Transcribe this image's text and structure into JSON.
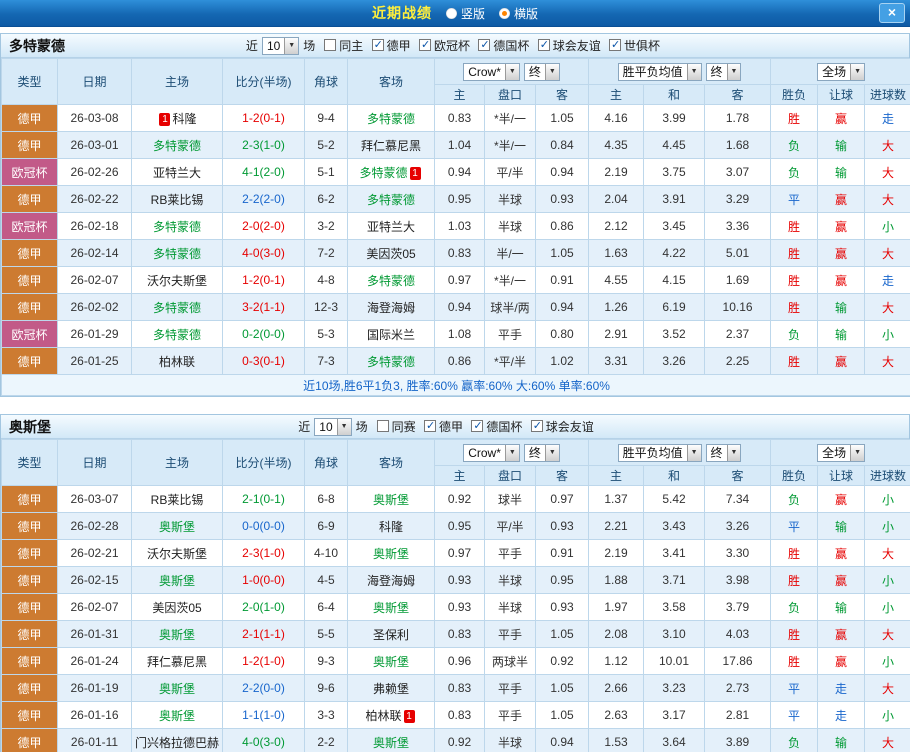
{
  "icons": {
    "close": "×",
    "dropdown_arrow": "▼",
    "checkbox_check": "✓"
  },
  "title_bar": {
    "title": "近期战绩",
    "radios": [
      {
        "label": "竖版",
        "selected": false,
        "cls": "radio"
      },
      {
        "label": "横版",
        "selected": true,
        "cls": "radio on"
      }
    ]
  },
  "filter_labels": {
    "near": "近",
    "games": "场"
  },
  "header_selects": {
    "odds_source": "Crow*",
    "odds_time": "终",
    "europe_source": "胜平负均值",
    "europe_time": "终",
    "scope": "全场"
  },
  "columns": [
    "类型",
    "日期",
    "主场",
    "比分(半场)",
    "角球",
    "客场",
    "主",
    "盘口",
    "客",
    "主",
    "和",
    "客",
    "胜负",
    "让球",
    "进球数"
  ],
  "sections": [
    {
      "team": "多特蒙德",
      "filter": {
        "count": "10",
        "checks": [
          {
            "label": "同主",
            "cls": "cb"
          },
          {
            "label": "德甲",
            "cls": "cb on"
          },
          {
            "label": "欧冠杯",
            "cls": "cb on"
          },
          {
            "label": "德国杯",
            "cls": "cb on"
          },
          {
            "label": "球会友谊",
            "cls": "cb on"
          },
          {
            "label": "世俱杯",
            "cls": "cb on"
          }
        ]
      },
      "rows": [
        {
          "lg": "德甲",
          "lgc": "lg-de",
          "date": "26-03-08",
          "hb": "1",
          "home": "科隆",
          "hc": "c-blk",
          "hba": "",
          "score": "1-2(0-1)",
          "sc": "c-red",
          "corner": "9-4",
          "ab": "",
          "away": "多特蒙德",
          "ac": "c-grn",
          "aba": "",
          "o1": "0.83",
          "pk": "*半/一",
          "o2": "1.05",
          "e1": "4.16",
          "e2": "3.99",
          "e3": "1.78",
          "r1": "胜",
          "r1c": "c-red",
          "r2": "赢",
          "r2c": "c-red",
          "r3": "走",
          "r3c": "c-blu"
        },
        {
          "lg": "德甲",
          "lgc": "lg-de",
          "date": "26-03-01",
          "hb": "",
          "home": "多特蒙德",
          "hc": "c-grn",
          "hba": "",
          "score": "2-3(1-0)",
          "sc": "c-grn",
          "corner": "5-2",
          "ab": "",
          "away": "拜仁慕尼黑",
          "ac": "c-blk",
          "aba": "",
          "o1": "1.04",
          "pk": "*半/一",
          "o2": "0.84",
          "e1": "4.35",
          "e2": "4.45",
          "e3": "1.68",
          "r1": "负",
          "r1c": "c-grn",
          "r2": "输",
          "r2c": "c-grn",
          "r3": "大",
          "r3c": "c-red"
        },
        {
          "lg": "欧冠杯",
          "lgc": "lg-cl",
          "date": "26-02-26",
          "hb": "",
          "home": "亚特兰大",
          "hc": "c-blk",
          "hba": "",
          "score": "4-1(2-0)",
          "sc": "c-grn",
          "corner": "5-1",
          "ab": "",
          "away": "多特蒙德",
          "ac": "c-grn",
          "aba": "1",
          "o1": "0.94",
          "pk": "平/半",
          "o2": "0.94",
          "e1": "2.19",
          "e2": "3.75",
          "e3": "3.07",
          "r1": "负",
          "r1c": "c-grn",
          "r2": "输",
          "r2c": "c-grn",
          "r3": "大",
          "r3c": "c-red"
        },
        {
          "lg": "德甲",
          "lgc": "lg-de",
          "date": "26-02-22",
          "hb": "",
          "home": "RB莱比锡",
          "hc": "c-blk",
          "hba": "",
          "score": "2-2(2-0)",
          "sc": "c-blu",
          "corner": "6-2",
          "ab": "",
          "away": "多特蒙德",
          "ac": "c-grn",
          "aba": "",
          "o1": "0.95",
          "pk": "半球",
          "o2": "0.93",
          "e1": "2.04",
          "e2": "3.91",
          "e3": "3.29",
          "r1": "平",
          "r1c": "c-blu",
          "r2": "赢",
          "r2c": "c-red",
          "r3": "大",
          "r3c": "c-red"
        },
        {
          "lg": "欧冠杯",
          "lgc": "lg-cl",
          "date": "26-02-18",
          "hb": "",
          "home": "多特蒙德",
          "hc": "c-grn",
          "hba": "",
          "score": "2-0(2-0)",
          "sc": "c-red",
          "corner": "3-2",
          "ab": "",
          "away": "亚特兰大",
          "ac": "c-blk",
          "aba": "",
          "o1": "1.03",
          "pk": "半球",
          "o2": "0.86",
          "e1": "2.12",
          "e2": "3.45",
          "e3": "3.36",
          "r1": "胜",
          "r1c": "c-red",
          "r2": "赢",
          "r2c": "c-red",
          "r3": "小",
          "r3c": "c-grn"
        },
        {
          "lg": "德甲",
          "lgc": "lg-de",
          "date": "26-02-14",
          "hb": "",
          "home": "多特蒙德",
          "hc": "c-grn",
          "hba": "",
          "score": "4-0(3-0)",
          "sc": "c-red",
          "corner": "7-2",
          "ab": "",
          "away": "美因茨05",
          "ac": "c-blk",
          "aba": "",
          "o1": "0.83",
          "pk": "半/一",
          "o2": "1.05",
          "e1": "1.63",
          "e2": "4.22",
          "e3": "5.01",
          "r1": "胜",
          "r1c": "c-red",
          "r2": "赢",
          "r2c": "c-red",
          "r3": "大",
          "r3c": "c-red"
        },
        {
          "lg": "德甲",
          "lgc": "lg-de",
          "date": "26-02-07",
          "hb": "",
          "home": "沃尔夫斯堡",
          "hc": "c-blk",
          "hba": "",
          "score": "1-2(0-1)",
          "sc": "c-red",
          "corner": "4-8",
          "ab": "",
          "away": "多特蒙德",
          "ac": "c-grn",
          "aba": "",
          "o1": "0.97",
          "pk": "*半/一",
          "o2": "0.91",
          "e1": "4.55",
          "e2": "4.15",
          "e3": "1.69",
          "r1": "胜",
          "r1c": "c-red",
          "r2": "赢",
          "r2c": "c-red",
          "r3": "走",
          "r3c": "c-blu"
        },
        {
          "lg": "德甲",
          "lgc": "lg-de",
          "date": "26-02-02",
          "hb": "",
          "home": "多特蒙德",
          "hc": "c-grn",
          "hba": "",
          "score": "3-2(1-1)",
          "sc": "c-red",
          "corner": "12-3",
          "ab": "",
          "away": "海登海姆",
          "ac": "c-blk",
          "aba": "",
          "o1": "0.94",
          "pk": "球半/两",
          "o2": "0.94",
          "e1": "1.26",
          "e2": "6.19",
          "e3": "10.16",
          "r1": "胜",
          "r1c": "c-red",
          "r2": "输",
          "r2c": "c-grn",
          "r3": "大",
          "r3c": "c-red"
        },
        {
          "lg": "欧冠杯",
          "lgc": "lg-cl",
          "date": "26-01-29",
          "hb": "",
          "home": "多特蒙德",
          "hc": "c-grn",
          "hba": "",
          "score": "0-2(0-0)",
          "sc": "c-grn",
          "corner": "5-3",
          "ab": "",
          "away": "国际米兰",
          "ac": "c-blk",
          "aba": "",
          "o1": "1.08",
          "pk": "平手",
          "o2": "0.80",
          "e1": "2.91",
          "e2": "3.52",
          "e3": "2.37",
          "r1": "负",
          "r1c": "c-grn",
          "r2": "输",
          "r2c": "c-grn",
          "r3": "小",
          "r3c": "c-grn"
        },
        {
          "lg": "德甲",
          "lgc": "lg-de",
          "date": "26-01-25",
          "hb": "",
          "home": "柏林联",
          "hc": "c-blk",
          "hba": "",
          "score": "0-3(0-1)",
          "sc": "c-red",
          "corner": "7-3",
          "ab": "",
          "away": "多特蒙德",
          "ac": "c-grn",
          "aba": "",
          "o1": "0.86",
          "pk": "*平/半",
          "o2": "1.02",
          "e1": "3.31",
          "e2": "3.26",
          "e3": "2.25",
          "r1": "胜",
          "r1c": "c-red",
          "r2": "赢",
          "r2c": "c-red",
          "r3": "大",
          "r3c": "c-red"
        }
      ],
      "summary": "近10场,胜6平1负3, 胜率:60%  赢率:60%  大:60%  单率:60%"
    },
    {
      "team": "奥斯堡",
      "filter": {
        "count": "10",
        "checks": [
          {
            "label": "同赛",
            "cls": "cb"
          },
          {
            "label": "德甲",
            "cls": "cb on"
          },
          {
            "label": "德国杯",
            "cls": "cb on"
          },
          {
            "label": "球会友谊",
            "cls": "cb on"
          }
        ]
      },
      "rows": [
        {
          "lg": "德甲",
          "lgc": "lg-de",
          "date": "26-03-07",
          "hb": "",
          "home": "RB莱比锡",
          "hc": "c-blk",
          "hba": "",
          "score": "2-1(0-1)",
          "sc": "c-grn",
          "corner": "6-8",
          "ab": "",
          "away": "奥斯堡",
          "ac": "c-grn",
          "aba": "",
          "o1": "0.92",
          "pk": "球半",
          "o2": "0.97",
          "e1": "1.37",
          "e2": "5.42",
          "e3": "7.34",
          "r1": "负",
          "r1c": "c-grn",
          "r2": "赢",
          "r2c": "c-red",
          "r3": "小",
          "r3c": "c-grn"
        },
        {
          "lg": "德甲",
          "lgc": "lg-de",
          "date": "26-02-28",
          "hb": "",
          "home": "奥斯堡",
          "hc": "c-grn",
          "hba": "",
          "score": "0-0(0-0)",
          "sc": "c-blu",
          "corner": "6-9",
          "ab": "",
          "away": "科隆",
          "ac": "c-blk",
          "aba": "",
          "o1": "0.95",
          "pk": "平/半",
          "o2": "0.93",
          "e1": "2.21",
          "e2": "3.43",
          "e3": "3.26",
          "r1": "平",
          "r1c": "c-blu",
          "r2": "输",
          "r2c": "c-grn",
          "r3": "小",
          "r3c": "c-grn"
        },
        {
          "lg": "德甲",
          "lgc": "lg-de",
          "date": "26-02-21",
          "hb": "",
          "home": "沃尔夫斯堡",
          "hc": "c-blk",
          "hba": "",
          "score": "2-3(1-0)",
          "sc": "c-red",
          "corner": "4-10",
          "ab": "",
          "away": "奥斯堡",
          "ac": "c-grn",
          "aba": "",
          "o1": "0.97",
          "pk": "平手",
          "o2": "0.91",
          "e1": "2.19",
          "e2": "3.41",
          "e3": "3.30",
          "r1": "胜",
          "r1c": "c-red",
          "r2": "赢",
          "r2c": "c-red",
          "r3": "大",
          "r3c": "c-red"
        },
        {
          "lg": "德甲",
          "lgc": "lg-de",
          "date": "26-02-15",
          "hb": "",
          "home": "奥斯堡",
          "hc": "c-grn",
          "hba": "",
          "score": "1-0(0-0)",
          "sc": "c-red",
          "corner": "4-5",
          "ab": "",
          "away": "海登海姆",
          "ac": "c-blk",
          "aba": "",
          "o1": "0.93",
          "pk": "半球",
          "o2": "0.95",
          "e1": "1.88",
          "e2": "3.71",
          "e3": "3.98",
          "r1": "胜",
          "r1c": "c-red",
          "r2": "赢",
          "r2c": "c-red",
          "r3": "小",
          "r3c": "c-grn"
        },
        {
          "lg": "德甲",
          "lgc": "lg-de",
          "date": "26-02-07",
          "hb": "",
          "home": "美因茨05",
          "hc": "c-blk",
          "hba": "",
          "score": "2-0(1-0)",
          "sc": "c-grn",
          "corner": "6-4",
          "ab": "",
          "away": "奥斯堡",
          "ac": "c-grn",
          "aba": "",
          "o1": "0.93",
          "pk": "半球",
          "o2": "0.93",
          "e1": "1.97",
          "e2": "3.58",
          "e3": "3.79",
          "r1": "负",
          "r1c": "c-grn",
          "r2": "输",
          "r2c": "c-grn",
          "r3": "小",
          "r3c": "c-grn"
        },
        {
          "lg": "德甲",
          "lgc": "lg-de",
          "date": "26-01-31",
          "hb": "",
          "home": "奥斯堡",
          "hc": "c-grn",
          "hba": "",
          "score": "2-1(1-1)",
          "sc": "c-red",
          "corner": "5-5",
          "ab": "",
          "away": "圣保利",
          "ac": "c-blk",
          "aba": "",
          "o1": "0.83",
          "pk": "平手",
          "o2": "1.05",
          "e1": "2.08",
          "e2": "3.10",
          "e3": "4.03",
          "r1": "胜",
          "r1c": "c-red",
          "r2": "赢",
          "r2c": "c-red",
          "r3": "大",
          "r3c": "c-red"
        },
        {
          "lg": "德甲",
          "lgc": "lg-de",
          "date": "26-01-24",
          "hb": "",
          "home": "拜仁慕尼黑",
          "hc": "c-blk",
          "hba": "",
          "score": "1-2(1-0)",
          "sc": "c-red",
          "corner": "9-3",
          "ab": "",
          "away": "奥斯堡",
          "ac": "c-grn",
          "aba": "",
          "o1": "0.96",
          "pk": "两球半",
          "o2": "0.92",
          "e1": "1.12",
          "e2": "10.01",
          "e3": "17.86",
          "r1": "胜",
          "r1c": "c-red",
          "r2": "赢",
          "r2c": "c-red",
          "r3": "小",
          "r3c": "c-grn"
        },
        {
          "lg": "德甲",
          "lgc": "lg-de",
          "date": "26-01-19",
          "hb": "",
          "home": "奥斯堡",
          "hc": "c-grn",
          "hba": "",
          "score": "2-2(0-0)",
          "sc": "c-blu",
          "corner": "9-6",
          "ab": "",
          "away": "弗赖堡",
          "ac": "c-blk",
          "aba": "",
          "o1": "0.83",
          "pk": "平手",
          "o2": "1.05",
          "e1": "2.66",
          "e2": "3.23",
          "e3": "2.73",
          "r1": "平",
          "r1c": "c-blu",
          "r2": "走",
          "r2c": "c-blu",
          "r3": "大",
          "r3c": "c-red"
        },
        {
          "lg": "德甲",
          "lgc": "lg-de",
          "date": "26-01-16",
          "hb": "",
          "home": "奥斯堡",
          "hc": "c-grn",
          "hba": "",
          "score": "1-1(1-0)",
          "sc": "c-blu",
          "corner": "3-3",
          "ab": "",
          "away": "柏林联",
          "ac": "c-blk",
          "aba": "1",
          "o1": "0.83",
          "pk": "平手",
          "o2": "1.05",
          "e1": "2.63",
          "e2": "3.17",
          "e3": "2.81",
          "r1": "平",
          "r1c": "c-blu",
          "r2": "走",
          "r2c": "c-blu",
          "r3": "小",
          "r3c": "c-grn"
        },
        {
          "lg": "德甲",
          "lgc": "lg-de",
          "date": "26-01-11",
          "hb": "",
          "home": "门兴格拉德巴赫",
          "hc": "c-blk",
          "hba": "",
          "score": "4-0(3-0)",
          "sc": "c-grn",
          "corner": "2-2",
          "ab": "",
          "away": "奥斯堡",
          "ac": "c-grn",
          "aba": "",
          "o1": "0.92",
          "pk": "半球",
          "o2": "0.94",
          "e1": "1.53",
          "e2": "3.64",
          "e3": "3.89",
          "r1": "负",
          "r1c": "c-grn",
          "r2": "输",
          "r2c": "c-grn",
          "r3": "大",
          "r3c": "c-red"
        }
      ],
      "summary": ""
    }
  ]
}
